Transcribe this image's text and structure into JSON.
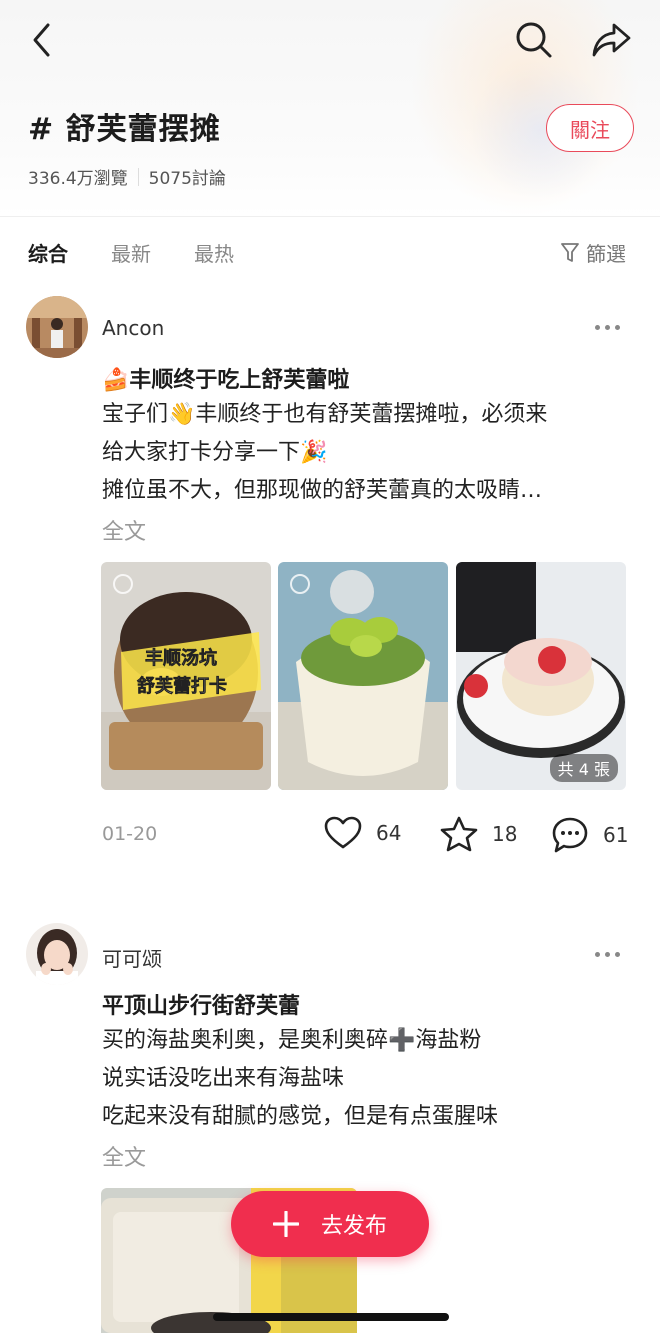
{
  "header": {
    "topic_title": "# 舒芙蕾摆摊",
    "follow_label": "關注",
    "views": "336.4万瀏覽",
    "discussions": "5075討論"
  },
  "tabs": [
    {
      "label": "综合",
      "active": true
    },
    {
      "label": "最新",
      "active": false
    },
    {
      "label": "最热",
      "active": false
    }
  ],
  "filter_label": "篩選",
  "posts": [
    {
      "username": "Ancon",
      "title": "🍰丰顺终于吃上舒芙蕾啦",
      "body": [
        "宝子们👋丰顺终于也有舒芙蕾摆摊啦，必须来",
        "给大家打卡分享一下🎉",
        "摊位虽不大，但那现做的舒芙蕾真的太吸睛…"
      ],
      "full_text_label": "全文",
      "image_overlay_text": [
        "丰顺汤坑",
        "舒芙蕾打卡"
      ],
      "image_count": "共 4 張",
      "date": "01-20",
      "likes": "64",
      "favorites": "18",
      "comments": "61"
    },
    {
      "username": "可可颂",
      "title": "平顶山步行街舒芙蕾",
      "body": [
        "买的海盐奥利奥，是奥利奥碎➕海盐粉",
        "说实话没吃出来有海盐味",
        "吃起来没有甜腻的感觉，但是有点蛋腥味"
      ],
      "full_text_label": "全文"
    }
  ],
  "publish_label": "去发布",
  "icons": {
    "back": "chevron-left-icon",
    "search": "search-icon",
    "share": "share-icon",
    "filter": "funnel-icon",
    "like": "heart-icon",
    "favorite": "star-icon",
    "comment": "comment-icon",
    "publish": "plus-icon"
  },
  "colors": {
    "accent": "#f02e4e",
    "follow": "#e94a5a"
  }
}
